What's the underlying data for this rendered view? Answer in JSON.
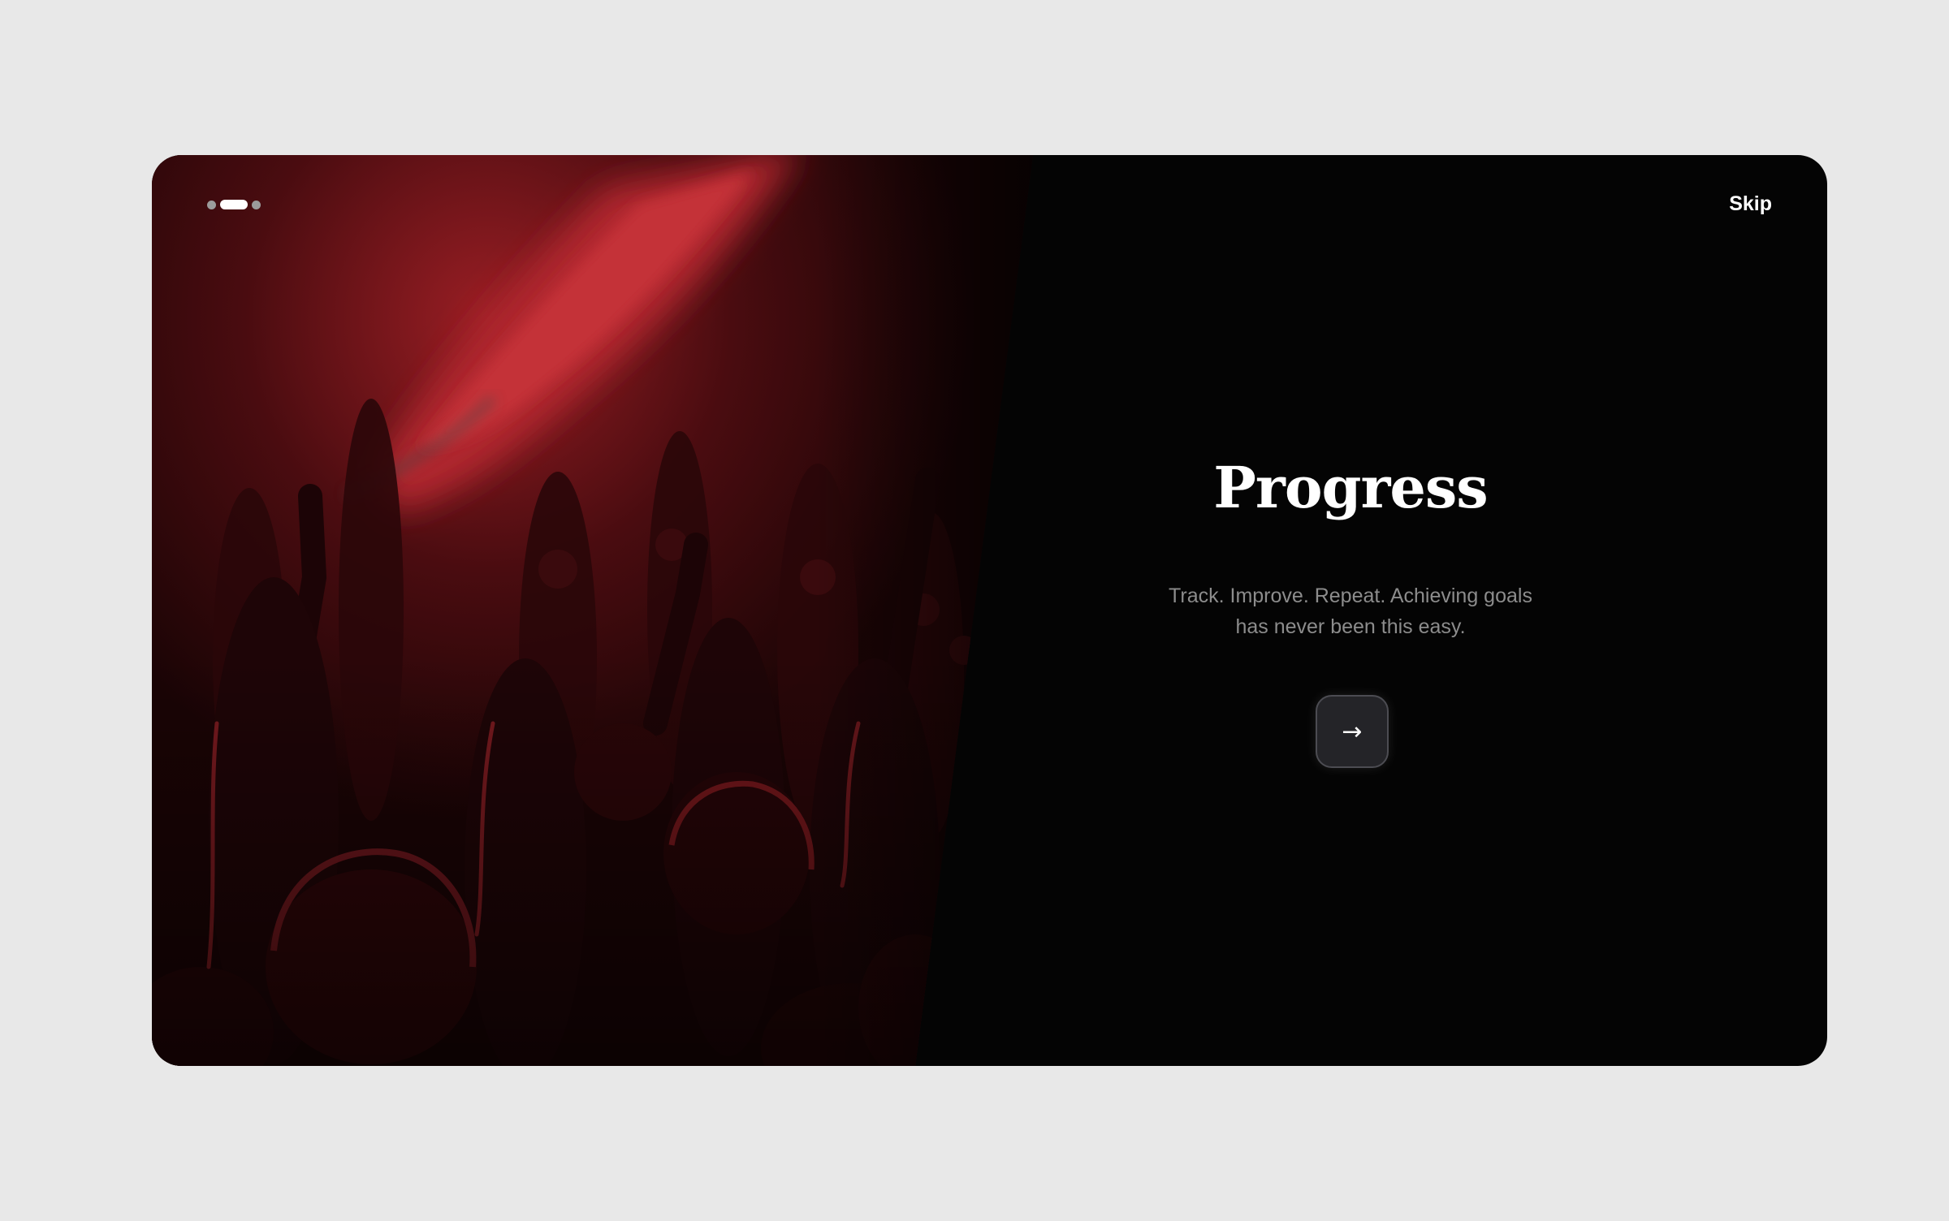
{
  "onboarding": {
    "pagination": {
      "total": 3,
      "active_index": 1
    },
    "skip_label": "Skip",
    "title": "Progress",
    "subtitle_line1": "Track. Improve. Repeat. Achieving goals",
    "subtitle_line2": "has never been this easy.",
    "next_button_icon": "arrow-right-icon",
    "next_button_glyph": "→"
  },
  "colors": {
    "page_background": "#e8e8e8",
    "card_background": "#040404",
    "accent_red": "#a8242c",
    "title": "#ffffff",
    "subtitle": "#8c8c8c",
    "button_background": "#242428"
  }
}
